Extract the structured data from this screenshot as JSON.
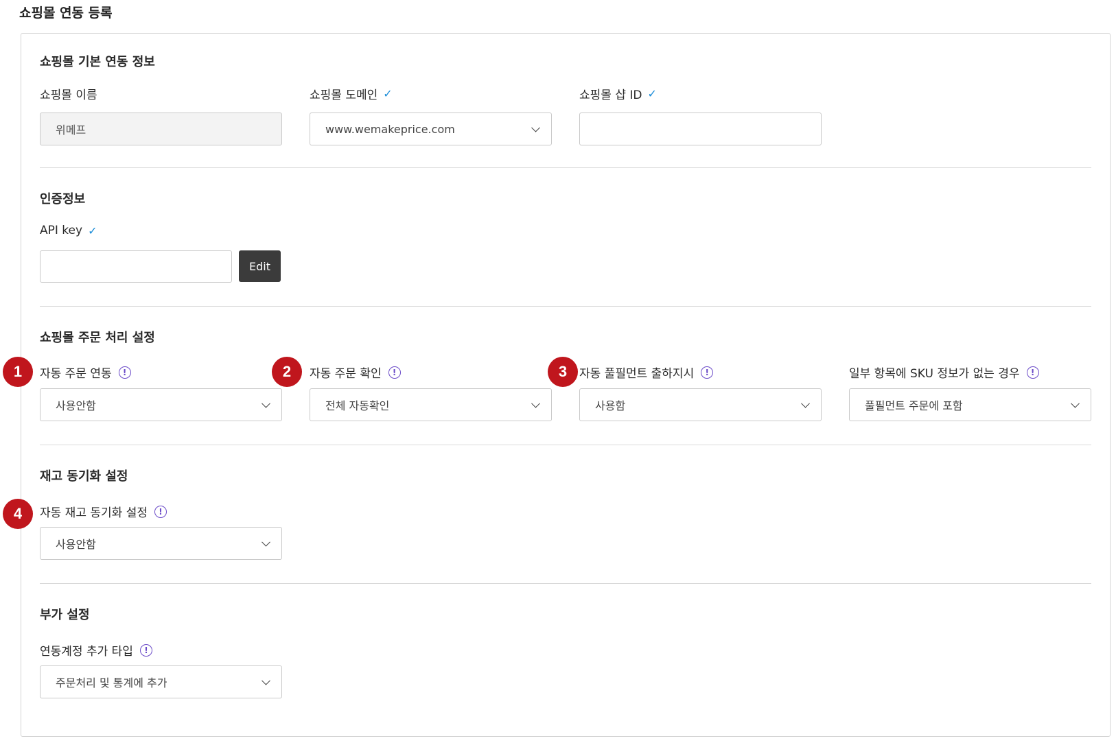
{
  "page_title": "쇼핑몰 연동 등록",
  "sections": {
    "basic": {
      "title": "쇼핑몰 기본 연동 정보",
      "name_label": "쇼핑몰 이름",
      "name_value": "위메프",
      "domain_label": "쇼핑몰 도메인",
      "domain_value": "www.wemakeprice.com",
      "shop_id_label": "쇼핑몰 샵 ID",
      "shop_id_value": ""
    },
    "auth": {
      "title": "인증정보",
      "api_key_label": "API key",
      "api_key_value": "",
      "edit_label": "Edit"
    },
    "order": {
      "title": "쇼핑몰 주문 처리 설정",
      "auto_link_label": "자동 주문 연동",
      "auto_link_value": "사용안함",
      "auto_confirm_label": "자동 주문 확인",
      "auto_confirm_value": "전체 자동확인",
      "auto_fulfill_label": "자동 풀필먼트 출하지시",
      "auto_fulfill_value": "사용함",
      "sku_missing_label": "일부 항목에 SKU 정보가 없는 경우",
      "sku_missing_value": "풀필먼트 주문에 포함"
    },
    "inventory": {
      "title": "재고 동기화 설정",
      "auto_sync_label": "자동 재고 동기화 설정",
      "auto_sync_value": "사용안함"
    },
    "extra": {
      "title": "부가 설정",
      "account_type_label": "연동계정 추가 타입",
      "account_type_value": "주문처리 및 통계에 추가"
    }
  },
  "badges": [
    "1",
    "2",
    "3",
    "4"
  ],
  "icons": {
    "check": "✓",
    "info": "!"
  },
  "colors": {
    "badge": "#c0161d",
    "check": "#1a8cd8",
    "info": "#6b4bc8",
    "button": "#3b3b3b"
  }
}
